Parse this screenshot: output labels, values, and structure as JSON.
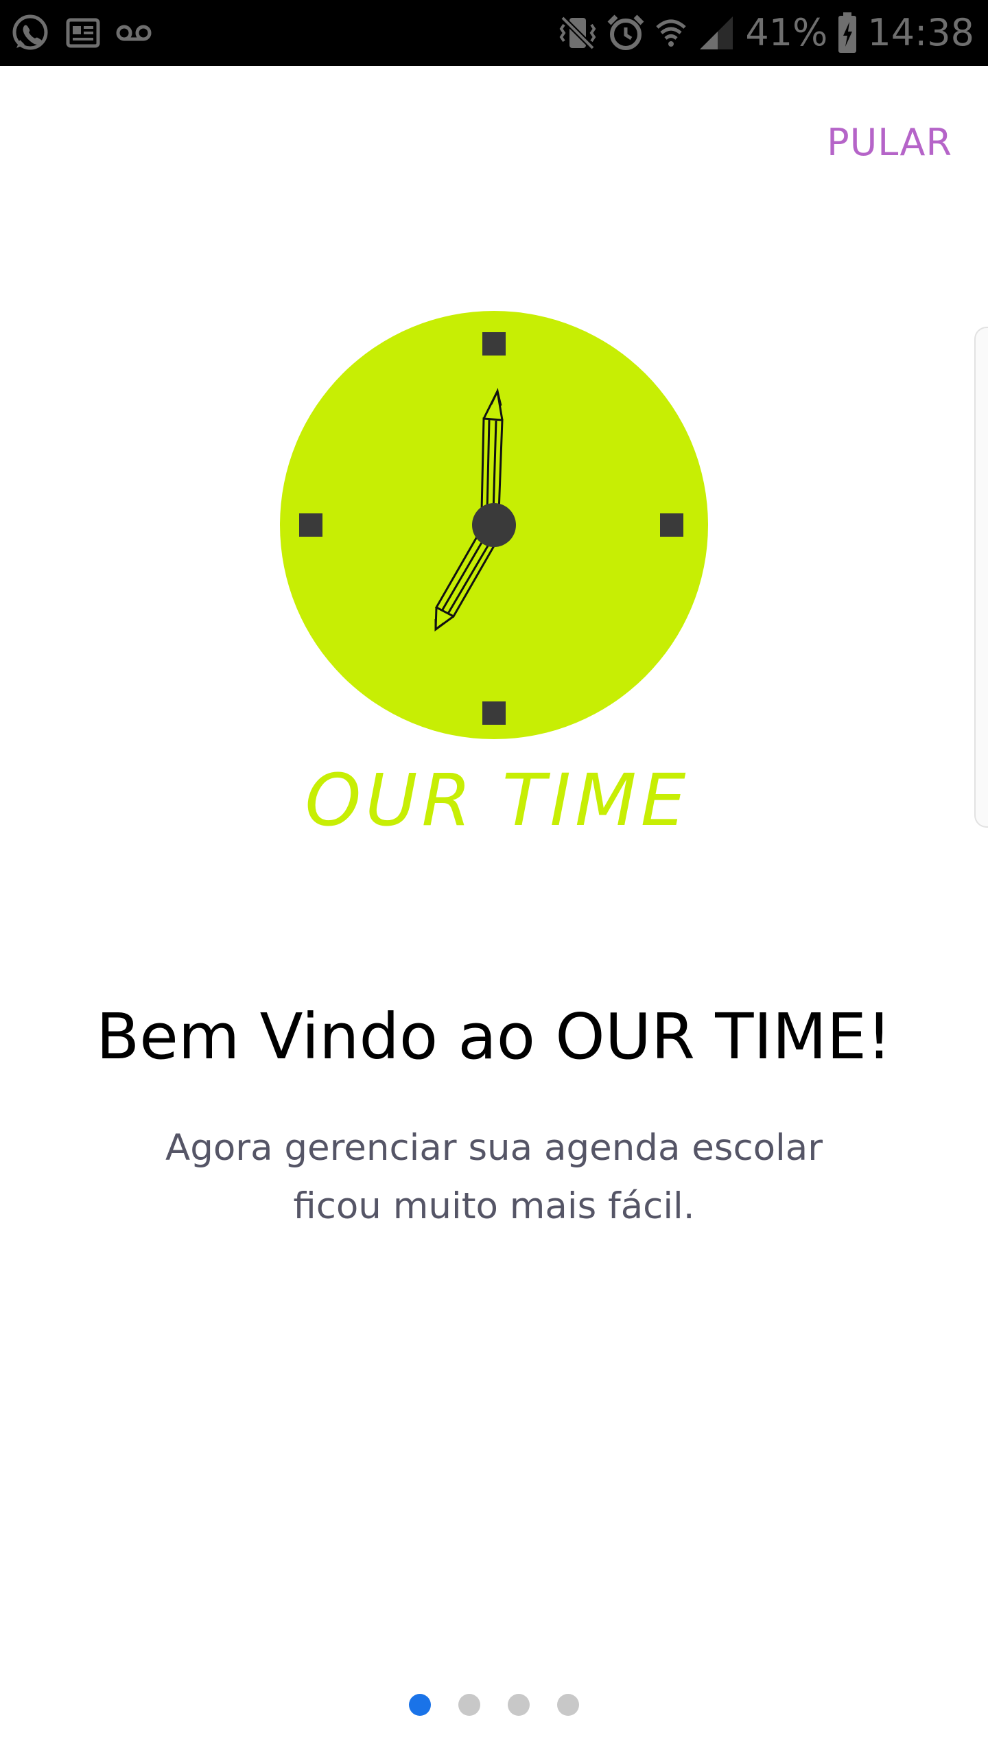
{
  "status_bar": {
    "battery_percent": "41%",
    "time": "14:38",
    "icons": [
      "whatsapp-icon",
      "news-icon",
      "voicemail-icon",
      "vibrate-icon",
      "alarm-icon",
      "wifi-icon",
      "signal-icon",
      "battery-charging-icon"
    ]
  },
  "skip_label": "PULAR",
  "logo": {
    "text": "OUR TIME",
    "colors": {
      "face": "#c7ee04",
      "marks": "#3a3a3a"
    }
  },
  "welcome": {
    "title": "Bem Vindo ao OUR TIME!",
    "line1": "Agora gerenciar sua agenda escolar",
    "line2": "ficou muito mais fácil."
  },
  "pager": {
    "pages": 4,
    "active_index": 0,
    "colors": {
      "active": "#1a73e8",
      "inactive": "#c8c8c8"
    }
  },
  "colors": {
    "accent": "#b564c8",
    "title": "#000000",
    "body_text": "#555566"
  }
}
